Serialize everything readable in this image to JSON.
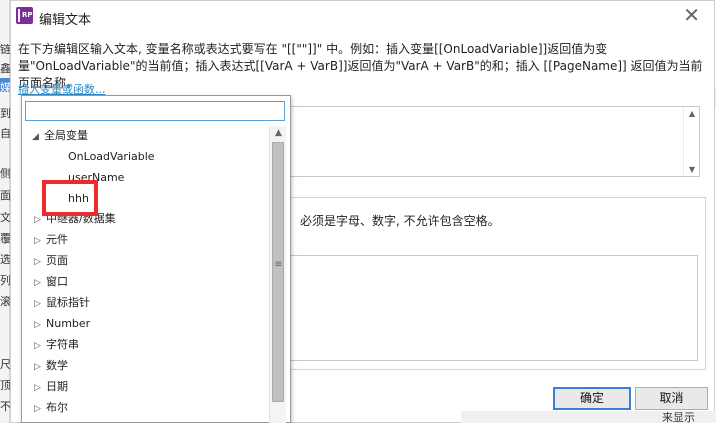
{
  "background_window": {
    "left_chars": [
      "链",
      "鑫",
      "媒",
      "到",
      "自",
      "侧",
      "面",
      "文",
      "覆",
      "选",
      "列",
      "滚",
      "尺",
      "顶",
      "不"
    ]
  },
  "dialog": {
    "title": "编辑文本",
    "app_icon_label": "RP",
    "close_glyph": "✕",
    "description": "在下方编辑区输入文本, 变量名称或表达式要写在 \"[[\"\"]]\" 中。例如：插入变量[[OnLoadVariable]]返回值为变量\"OnLoadVariable\"的当前值；插入表达式[[VarA + VarB]]返回值为\"VarA + VarB\"的和；插入 [[PageName]] 返回值为当前页面名称。",
    "insert_link": "插入变量或函数...",
    "hint_text": "必须是字母、数字, 不允许包含空格。",
    "ok_button": "确定",
    "cancel_button": "取消",
    "bottom_cut_text": "来显示"
  },
  "popup": {
    "search_value": "",
    "items": [
      {
        "label": "全局变量",
        "expanded": true,
        "level": 0
      },
      {
        "label": "OnLoadVariable",
        "level": 1
      },
      {
        "label": "userName",
        "level": 1
      },
      {
        "label": "hhh",
        "level": 1
      },
      {
        "label": "中继器/数据集",
        "level": 0
      },
      {
        "label": "元件",
        "level": 0
      },
      {
        "label": "页面",
        "level": 0
      },
      {
        "label": "窗口",
        "level": 0
      },
      {
        "label": "鼠标指针",
        "level": 0
      },
      {
        "label": "Number",
        "level": 0
      },
      {
        "label": "字符串",
        "level": 0
      },
      {
        "label": "数学",
        "level": 0
      },
      {
        "label": "日期",
        "level": 0
      },
      {
        "label": "布尔",
        "level": 0
      }
    ]
  },
  "colors": {
    "accent_link": "#2b8ac6",
    "highlight_box": "#ee2a2a",
    "app_icon": "#7b2d9b",
    "ok_border": "#3c7fd4"
  }
}
